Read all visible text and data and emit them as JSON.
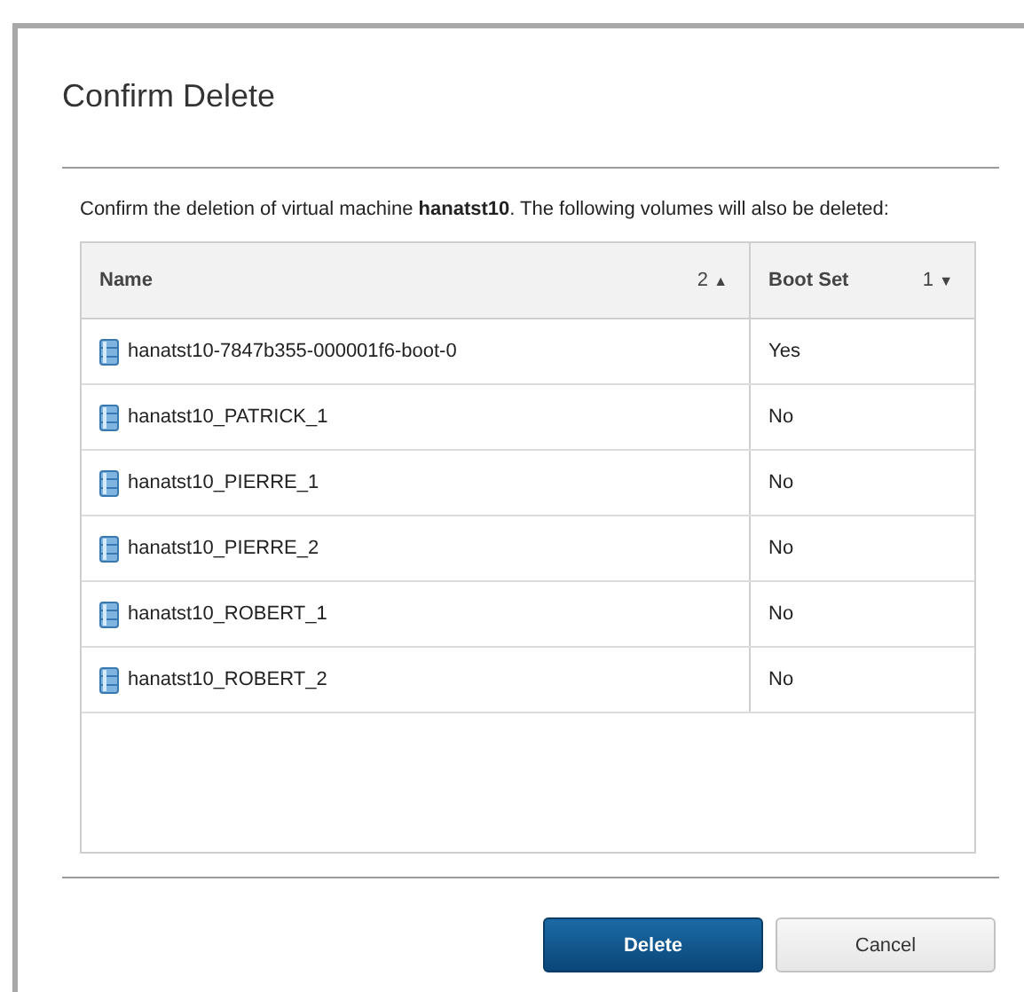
{
  "dialog": {
    "title": "Confirm Delete",
    "message": "Confirm the deletion of virtual machine **hanatst10**. The following volumes will also be deleted:"
  },
  "table": {
    "columns": [
      {
        "label": "Name",
        "sort_priority": "2",
        "sort_arrow": "▲"
      },
      {
        "label": "Boot Set",
        "sort_priority": "1",
        "sort_arrow": "▼"
      }
    ],
    "rows": [
      {
        "name": "hanatst10-7847b355-000001f6-boot-0",
        "boot_set": "Yes"
      },
      {
        "name": "hanatst10_PATRICK_1",
        "boot_set": "No"
      },
      {
        "name": "hanatst10_PIERRE_1",
        "boot_set": "No"
      },
      {
        "name": "hanatst10_PIERRE_2",
        "boot_set": "No"
      },
      {
        "name": "hanatst10_ROBERT_1",
        "boot_set": "No"
      },
      {
        "name": "hanatst10_ROBERT_2",
        "boot_set": "No"
      }
    ]
  },
  "buttons": [
    {
      "label": "Delete",
      "kind": "primary"
    },
    {
      "label": "Cancel",
      "kind": "secondary"
    }
  ]
}
